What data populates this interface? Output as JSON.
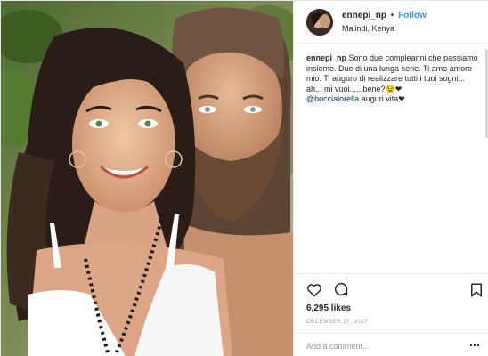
{
  "post": {
    "username": "ennepi_np",
    "separator": "•",
    "follow_label": "Follow",
    "location": "Malindi, Kenya",
    "caption": {
      "username": "ennepi_np",
      "text": "Sono due compleanni che passiamo insieme. Due di una lunga serie. Ti amo amore mio. Ti auguro di realizzare tutti i tuoi sogni... ah... mi vuoi......bene?😉❤",
      "mention": "@boccialorella",
      "mention_text": "auguri vita❤"
    },
    "likes": "6,295 likes",
    "date": "DECEMBER 27, 2017",
    "comment_placeholder": "Add a comment..."
  },
  "icons": {
    "like": "heart-icon",
    "comment": "comment-bubble-icon",
    "save": "bookmark-icon",
    "more": "more-options-icon"
  },
  "colors": {
    "follow": "#3897f0",
    "mention": "#003569",
    "muted": "#999999",
    "divider": "#efefef"
  }
}
